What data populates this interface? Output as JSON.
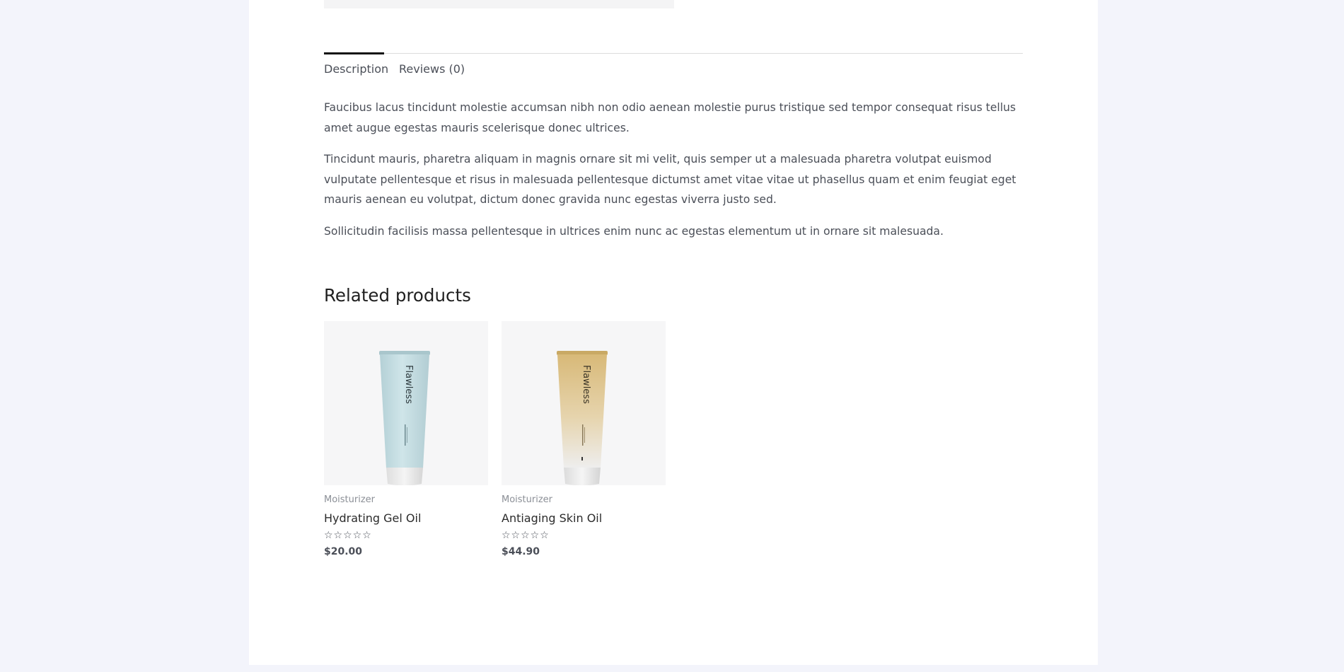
{
  "tabs": [
    {
      "label": "Description"
    },
    {
      "label": "Reviews (0)"
    }
  ],
  "description": {
    "paragraphs": [
      "Faucibus lacus tincidunt molestie accumsan nibh non odio aenean molestie purus tristique sed tempor consequat risus tellus amet augue egestas mauris scelerisque donec ultrices.",
      "Tincidunt mauris, pharetra aliquam in magnis ornare sit mi velit, quis semper ut a malesuada pharetra volutpat euismod vulputate pellentesque et risus in malesuada pellentesque dictumst amet vitae vitae ut phasellus quam et enim feugiat eget mauris aenean eu volutpat, dictum donec gravida nunc egestas viverra justo sed.",
      "Sollicitudin facilisis massa pellentesque in ultrices enim nunc ac egestas elementum ut in ornare sit malesuada."
    ]
  },
  "related": {
    "title": "Related products",
    "products": [
      {
        "category": "Moisturizer",
        "name": "Hydrating Gel Oil",
        "stars": "☆☆☆☆☆",
        "rating": 0,
        "price": "$20.00",
        "brand": "Flawless",
        "tube_color": "#c3dde2"
      },
      {
        "category": "Moisturizer",
        "name": "Antiaging Skin Oil",
        "stars": "☆☆☆☆☆",
        "rating": 0,
        "price": "$44.90",
        "brand": "Flawless",
        "tube_color": "#dcc287"
      }
    ]
  },
  "colors": {
    "background": "#f3f4fb",
    "card": "#ffffff",
    "text": "#4b4f58",
    "heading": "#1f1f1f"
  }
}
